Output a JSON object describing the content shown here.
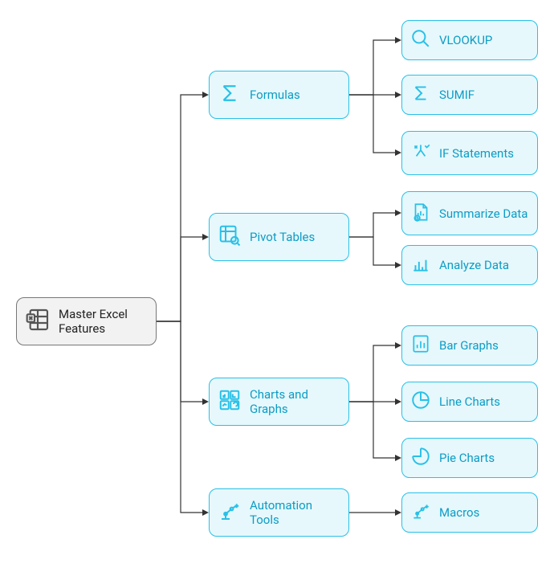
{
  "root": {
    "label": "Master Excel Features"
  },
  "branches": [
    {
      "key": "formulas",
      "label": "Formulas"
    },
    {
      "key": "pivot",
      "label": "Pivot Tables"
    },
    {
      "key": "charts",
      "label": "Charts and Graphs"
    },
    {
      "key": "automation",
      "label": "Automation Tools"
    }
  ],
  "leaves": {
    "formulas": [
      {
        "key": "vlookup",
        "label": "VLOOKUP"
      },
      {
        "key": "sumif",
        "label": "SUMIF"
      },
      {
        "key": "if",
        "label": "IF Statements"
      }
    ],
    "pivot": [
      {
        "key": "summarize",
        "label": "Summarize Data"
      },
      {
        "key": "analyze",
        "label": "Analyze Data"
      }
    ],
    "charts": [
      {
        "key": "bar",
        "label": "Bar Graphs"
      },
      {
        "key": "line",
        "label": "Line Charts"
      },
      {
        "key": "pie",
        "label": "Pie Charts"
      }
    ],
    "automation": [
      {
        "key": "macros",
        "label": "Macros"
      }
    ]
  },
  "colors": {
    "accent": "#29c0e7",
    "accentFill": "#e6f8fc",
    "neutral": "#777",
    "neutralFill": "#f2f2f2"
  }
}
